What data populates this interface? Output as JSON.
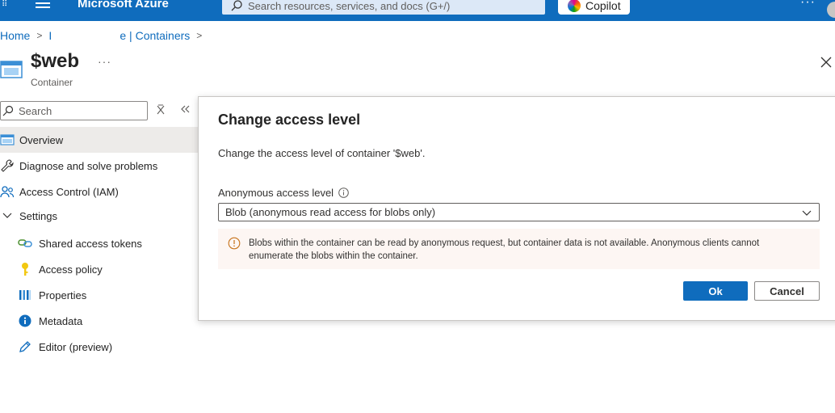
{
  "topbar": {
    "title": "Microsoft Azure",
    "search_placeholder": "Search resources, services, and docs (G+/)",
    "copilot_label": "Copilot",
    "more_label": "···"
  },
  "breadcrumb": {
    "home": "Home",
    "middle": "I",
    "middle_tail": "e | Containers"
  },
  "header": {
    "title": "$web",
    "subtitle": "Container",
    "more_label": "···"
  },
  "sidebar": {
    "search_placeholder": "Search",
    "items": [
      {
        "label": "Overview",
        "icon": "container-icon",
        "active": true
      },
      {
        "label": "Diagnose and solve problems",
        "icon": "wrench-icon"
      },
      {
        "label": "Access Control (IAM)",
        "icon": "people-icon"
      },
      {
        "label": "Settings",
        "icon": "chevron-down-icon"
      },
      {
        "label": "Shared access tokens",
        "icon": "link-icon"
      },
      {
        "label": "Access policy",
        "icon": "key-icon"
      },
      {
        "label": "Properties",
        "icon": "bars-icon"
      },
      {
        "label": "Metadata",
        "icon": "info-icon"
      },
      {
        "label": "Editor (preview)",
        "icon": "pencil-icon"
      }
    ]
  },
  "dialog": {
    "title": "Change access level",
    "description": "Change the access level of container '$web'.",
    "field_label": "Anonymous access level",
    "selected_value": "Blob (anonymous read access for blobs only)",
    "warning": "Blobs within the container can be read by anonymous request, but container data is not available. Anonymous clients cannot enumerate the blobs within the container.",
    "ok_label": "Ok",
    "cancel_label": "Cancel"
  },
  "colors": {
    "brand": "#0f6cbd",
    "warning_bg": "#fdf6f3",
    "warning_icon": "#c7721a"
  }
}
